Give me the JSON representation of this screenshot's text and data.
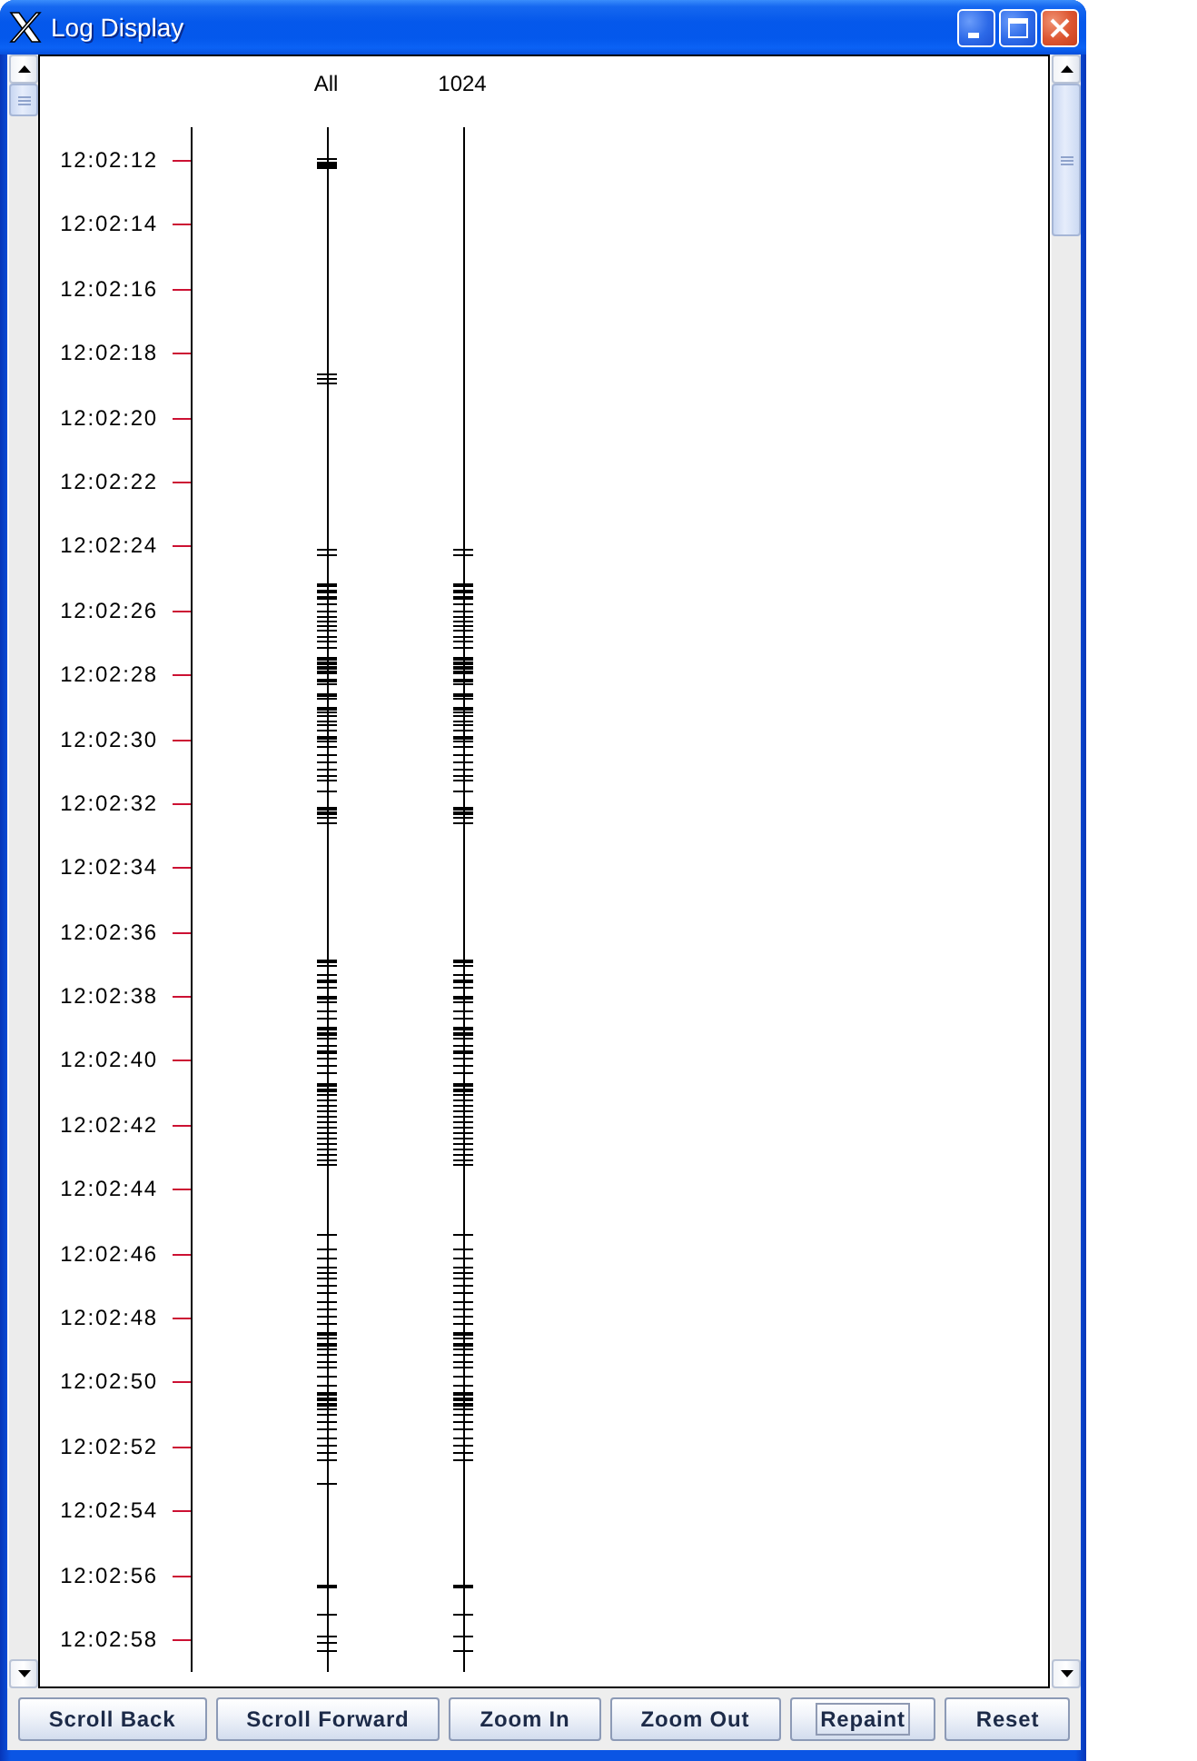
{
  "window": {
    "title": "Log Display"
  },
  "chart": {
    "tracks": [
      {
        "label": "All"
      },
      {
        "label": "1024"
      }
    ],
    "time_labels": [
      "12:02:12",
      "12:02:14",
      "12:02:16",
      "12:02:18",
      "12:02:20",
      "12:02:22",
      "12:02:24",
      "12:02:26",
      "12:02:28",
      "12:02:30",
      "12:02:32",
      "12:02:34",
      "12:02:36",
      "12:02:38",
      "12:02:40",
      "12:02:42",
      "12:02:44",
      "12:02:46",
      "12:02:48",
      "12:02:50",
      "12:02:52",
      "12:02:54",
      "12:02:56",
      "12:02:58"
    ]
  },
  "buttons": [
    {
      "label": "Scroll Back",
      "focused": false
    },
    {
      "label": "Scroll Forward",
      "focused": false
    },
    {
      "label": "Zoom In",
      "focused": false
    },
    {
      "label": "Zoom Out",
      "focused": false
    },
    {
      "label": "Repaint",
      "focused": true
    },
    {
      "label": "Reset",
      "focused": false
    }
  ]
}
